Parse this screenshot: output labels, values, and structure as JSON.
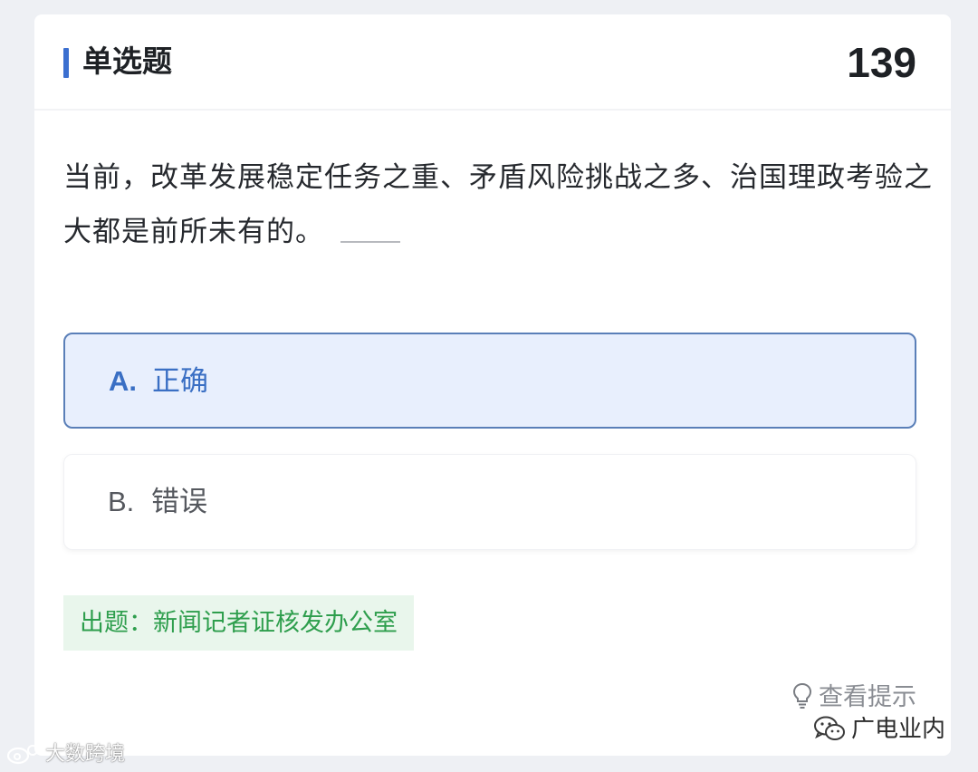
{
  "question": {
    "type_label": "单选题",
    "number": "139",
    "text": "当前，改革发展稳定任务之重、矛盾风险挑战之多、治国理政考验之大都是前所未有的。"
  },
  "options": [
    {
      "letter": "A.",
      "text": "正确",
      "selected": true
    },
    {
      "letter": "B.",
      "text": "错误",
      "selected": false
    }
  ],
  "source_tag": "出题：新闻记者证核发办公室",
  "hint": {
    "icon": "lightbulb-icon",
    "label": "查看提示"
  },
  "watermarks": {
    "wechat": {
      "icon": "wechat-icon",
      "label": "广电业内"
    },
    "weibo": {
      "icon": "weibo-icon",
      "label": "大数跨境"
    }
  },
  "colors": {
    "accent": "#3b6fd0",
    "selected_bg": "#e8effd",
    "selected_border": "#5a7fb8",
    "source_tag_bg": "#e9f6ec",
    "source_tag_text": "#2e9e4d"
  }
}
